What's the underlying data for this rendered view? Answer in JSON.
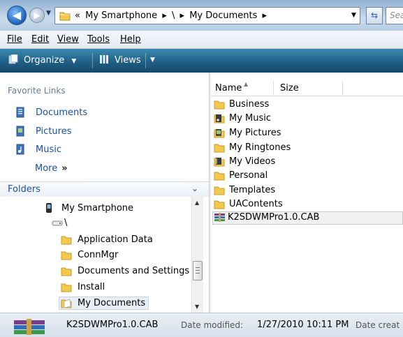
{
  "address": {
    "crumbs": [
      "«",
      "My Smartphone",
      "▸",
      "\\",
      "▸",
      "My Documents",
      "▸"
    ],
    "search_placeholder": "Sea"
  },
  "menu": [
    "File",
    "Edit",
    "View",
    "Tools",
    "Help"
  ],
  "commands": {
    "organize": "Organize",
    "views": "Views"
  },
  "favorites": {
    "title": "Favorite Links",
    "items": [
      "Documents",
      "Pictures",
      "Music"
    ],
    "more": "More",
    "more_arrow": "»"
  },
  "folders": {
    "title": "Folders",
    "tree": [
      {
        "label": "My Smartphone",
        "icon": "phone-icon"
      },
      {
        "label": "\\",
        "icon": "drive-icon"
      },
      {
        "label": "Application Data",
        "icon": "folder-icon"
      },
      {
        "label": "ConnMgr",
        "icon": "folder-icon"
      },
      {
        "label": "Documents and Settings",
        "icon": "folder-icon"
      },
      {
        "label": "Install",
        "icon": "folder-icon"
      },
      {
        "label": "My Documents",
        "icon": "folder-open-icon",
        "selected": true
      }
    ]
  },
  "columns": {
    "name": "Name",
    "size": "Size"
  },
  "files": [
    {
      "name": "Business",
      "icon": "folder-icon"
    },
    {
      "name": "My Music",
      "icon": "music-folder-icon"
    },
    {
      "name": "My Pictures",
      "icon": "pictures-folder-icon"
    },
    {
      "name": "My Ringtones",
      "icon": "folder-icon"
    },
    {
      "name": "My Videos",
      "icon": "videos-folder-icon"
    },
    {
      "name": "Personal",
      "icon": "folder-icon"
    },
    {
      "name": "Templates",
      "icon": "folder-icon"
    },
    {
      "name": "UAContents",
      "icon": "folder-icon"
    },
    {
      "name": "K2SDWMPro1.0.CAB",
      "icon": "archive-icon",
      "selected": true
    }
  ],
  "status": {
    "file_name": "K2SDWMPro1.0.CAB",
    "modified_label": "Date modified:",
    "modified_value": "1/27/2010 10:11 PM",
    "created_label": "Date creat"
  },
  "colors": {
    "link_blue": "#1c51a1",
    "cmdbar": "#1f5f86",
    "folder_yellow": "#f2c94c"
  }
}
